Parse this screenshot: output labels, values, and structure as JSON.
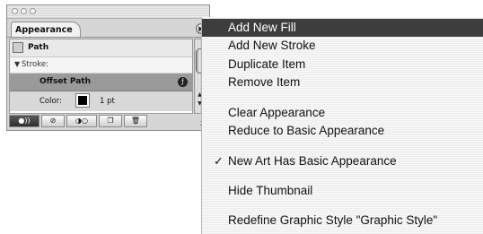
{
  "panel": {
    "tab_label": "Appearance",
    "menu_button_icon": "triangle-right-icon",
    "rows": {
      "path_label": "Path",
      "stroke_label": "Stroke:",
      "offset_path_label": "Offset Path",
      "color_label": "Color:",
      "stroke_weight": "1 pt"
    },
    "toolbar_icons": [
      "new-art-basic-appearance-icon",
      "clear-appearance-icon",
      "reduce-basic-appearance-icon",
      "duplicate-item-icon",
      "delete-item-icon"
    ]
  },
  "menu": {
    "items": [
      {
        "label": "Add New Fill",
        "highlighted": true
      },
      {
        "label": "Add New Stroke"
      },
      {
        "label": "Duplicate Item"
      },
      {
        "label": "Remove Item"
      },
      {
        "label": "Clear Appearance"
      },
      {
        "label": "Reduce to Basic Appearance"
      },
      {
        "label": "New Art Has Basic Appearance",
        "checked": true
      },
      {
        "label": "Hide Thumbnail"
      },
      {
        "label": "Redefine Graphic Style \"Graphic Style\""
      }
    ],
    "check_mark": "✓",
    "highlight_color": "#3d3d3d"
  }
}
